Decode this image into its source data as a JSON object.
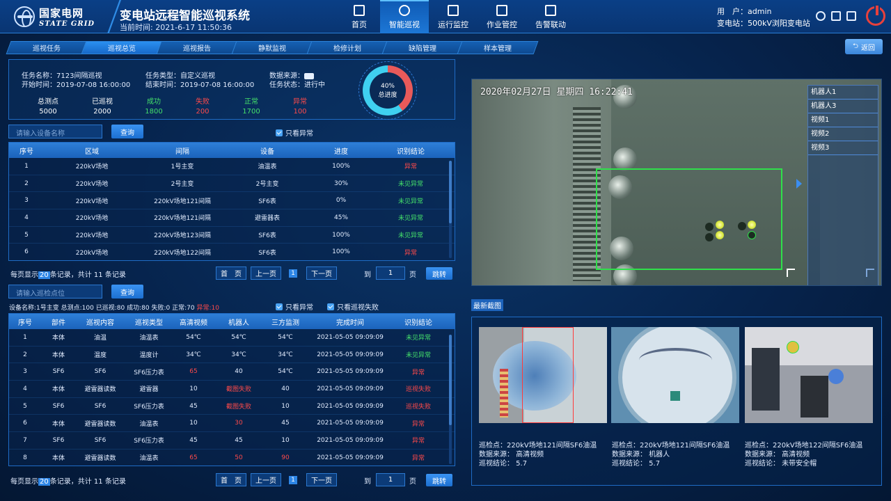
{
  "header": {
    "org_cn": "国家电网",
    "org_en": "STATE GRID",
    "title": "变电站远程智能巡视系统",
    "time_label": "当前时间:",
    "time_value": "2021-6-17  11:50:36",
    "user_label": "用　户：",
    "user_value": "admin",
    "station_label": "变电站：",
    "station_value": "500kV浏阳变电站"
  },
  "nav": [
    {
      "label": "首页",
      "icon": "home-icon"
    },
    {
      "label": "智能巡视",
      "icon": "gear-icon",
      "active": true
    },
    {
      "label": "运行监控",
      "icon": "monitor-icon"
    },
    {
      "label": "作业管控",
      "icon": "book-icon"
    },
    {
      "label": "告警联动",
      "icon": "warning-icon"
    }
  ],
  "tabs": [
    "巡视任务",
    "巡视总览",
    "巡视报告",
    "静默监视",
    "检修计划",
    "缺陷管理",
    "样本管理"
  ],
  "back_label": "返回",
  "task": {
    "name_label": "任务名称：",
    "name": "7123间隔巡视",
    "start_label": "开始时间：",
    "start": "2019-07-08 16:00:00",
    "type_label": "任务类型：",
    "type": "自定义巡视",
    "end_label": "结束时间：",
    "end": "2019-07-08 16:00:00",
    "source_label": "数据来源：",
    "status_label": "任务状态：",
    "status": "进行中",
    "counts": [
      {
        "label": "总测点",
        "value": "5000",
        "color": "#ffffff"
      },
      {
        "label": "已巡视",
        "value": "2000",
        "color": "#ffffff"
      },
      {
        "label": "成功",
        "value": "1800",
        "color": "#44e06a"
      },
      {
        "label": "失败",
        "value": "200",
        "color": "#ff4a4a"
      },
      {
        "label": "正常",
        "value": "1700",
        "color": "#44e06a"
      },
      {
        "label": "异常",
        "value": "100",
        "color": "#ff4a4a"
      }
    ],
    "progress_pct": "40%",
    "progress_label": "总进度",
    "progress_fraction": 0.4
  },
  "search1": {
    "placeholder": "请输入设备名称",
    "button": "查询",
    "filter": "只看异常"
  },
  "table1": {
    "headers": [
      "序号",
      "区域",
      "间隔",
      "设备",
      "进度",
      "识别结论"
    ],
    "rows": [
      [
        "1",
        "220kV场地",
        "1号主变",
        "油温表",
        "100%",
        "异常"
      ],
      [
        "2",
        "220kV场地",
        "2号主变",
        "2号主变",
        "30%",
        "未见异常"
      ],
      [
        "3",
        "220kV场地",
        "220kV场地121间隔",
        "SF6表",
        "0%",
        "未见异常"
      ],
      [
        "4",
        "220kV场地",
        "220kV场地121间隔",
        "避雷器表",
        "45%",
        "未见异常"
      ],
      [
        "5",
        "220kV场地",
        "220kV场地123间隔",
        "SF6表",
        "100%",
        "未见异常"
      ],
      [
        "6",
        "220kV场地",
        "220kV场地122间隔",
        "SF6表",
        "100%",
        "异常"
      ]
    ]
  },
  "pager1": {
    "pre": "每页显示",
    "size": "20",
    "post": "条记录，共计 11 条记录",
    "first": "首　页",
    "prev": "上一页",
    "page": "1",
    "next": "下一页",
    "goto": "到",
    "input": "1",
    "unit": "页",
    "jump": "跳转"
  },
  "search2": {
    "placeholder": "请输入巡检点位",
    "button": "查询",
    "filter1": "只看异常",
    "filter2": "只看巡视失败"
  },
  "summary": {
    "device": "设备名称:1号主变",
    "total": "总测点:100",
    "done": "已巡视:80",
    "ok": "成功:80",
    "fail": "失败:0",
    "normal": "正常:70",
    "abnormal": "异常:10"
  },
  "table2": {
    "headers": [
      "序号",
      "部件",
      "巡视内容",
      "巡视类型",
      "高清视频",
      "机器人",
      "三方监测",
      "完成时间",
      "识别结论"
    ],
    "rows": [
      [
        "1",
        "本体",
        "油温",
        "油温表",
        "54℃",
        "54℃",
        "54℃",
        "2021-05-05 09:09:09",
        "未见异常"
      ],
      [
        "2",
        "本体",
        "温度",
        "温度计",
        "34℃",
        "34℃",
        "34℃",
        "2021-05-05 09:09:09",
        "未见异常"
      ],
      [
        "3",
        "SF6",
        "SF6",
        "SF6压力表",
        "65",
        "40",
        "54℃",
        "2021-05-05 09:09:09",
        "异常"
      ],
      [
        "4",
        "本体",
        "避雷器读数",
        "避雷器",
        "10",
        "截图失败",
        "40",
        "2021-05-05 09:09:09",
        "巡视失败"
      ],
      [
        "5",
        "SF6",
        "SF6",
        "SF6压力表",
        "45",
        "截图失败",
        "10",
        "2021-05-05 09:09:09",
        "巡视失败"
      ],
      [
        "6",
        "本体",
        "避雷器读数",
        "油温表",
        "10",
        "30",
        "45",
        "2021-05-05 09:09:09",
        "异常"
      ],
      [
        "7",
        "SF6",
        "SF6",
        "SF6压力表",
        "45",
        "45",
        "10",
        "2021-05-05 09:09:09",
        "异常"
      ],
      [
        "8",
        "本体",
        "避雷器读数",
        "油温表",
        "65",
        "50",
        "90",
        "2021-05-05 09:09:09",
        "异常"
      ]
    ],
    "red_cells": [
      [
        2,
        4
      ],
      [
        3,
        5
      ],
      [
        4,
        5
      ],
      [
        5,
        5
      ],
      [
        7,
        4
      ],
      [
        7,
        5
      ],
      [
        7,
        6
      ]
    ]
  },
  "pager2": {
    "pre": "每页显示",
    "size": "20",
    "post": "条记录，共计 11 条记录",
    "first": "首　页",
    "prev": "上一页",
    "page": "1",
    "next": "下一页",
    "goto": "到",
    "input": "1",
    "unit": "页",
    "jump": "跳转"
  },
  "video": {
    "overlay_time": "2020年02月27日  星期四  16:22:41",
    "sources": [
      "机器人1",
      "机器人3",
      "视频1",
      "视频2",
      "视频3"
    ]
  },
  "shots": {
    "tab": "最新截图",
    "items": [
      {
        "point": "巡检点：220kV场地121间隔SF6油温",
        "source": "数据来源：  高清视频",
        "result": "巡视结论：  5.7"
      },
      {
        "point": "巡检点：220kV场地121间隔SF6油温",
        "source": "数据来源：  机器人",
        "result": "巡视结论：  5.7"
      },
      {
        "point": "巡检点：220kV场地122间隔SF6油温",
        "source": "数据来源：  高清视频",
        "result": "巡视结论：  未带安全帽"
      }
    ]
  }
}
